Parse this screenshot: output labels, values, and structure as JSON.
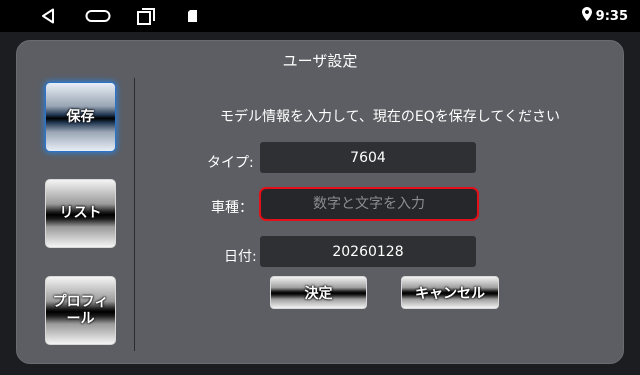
{
  "status_bar": {
    "back_icon": "back-triangle-icon",
    "home_icon": "home-pill-icon",
    "recents_icon": "recents-square-icon",
    "sd_icon": "sd-card-icon",
    "location_icon": "location-pin-icon",
    "time": "9:35"
  },
  "dialog": {
    "title": "ユーザ設定",
    "prompt": "モデル情報を入力して、現在のEQを保存してください"
  },
  "sidebar": {
    "items": [
      {
        "label": "保存",
        "active": true
      },
      {
        "label": "リスト",
        "active": false
      },
      {
        "label": "プロフィール",
        "active": false
      }
    ]
  },
  "form": {
    "type_label": "タイプ:",
    "type_value": "7604",
    "model_label": "車種：",
    "model_value": "",
    "model_placeholder": "数字と文字を入力",
    "date_label": "日付:",
    "date_value": "20260128"
  },
  "actions": {
    "confirm_label": "決定",
    "cancel_label": "キャンセル"
  },
  "colors": {
    "dialog_bg": "#5c5e63",
    "field_bg": "#2f3033",
    "focus_border": "#e3101a",
    "active_glow": "#2f7fd6"
  }
}
